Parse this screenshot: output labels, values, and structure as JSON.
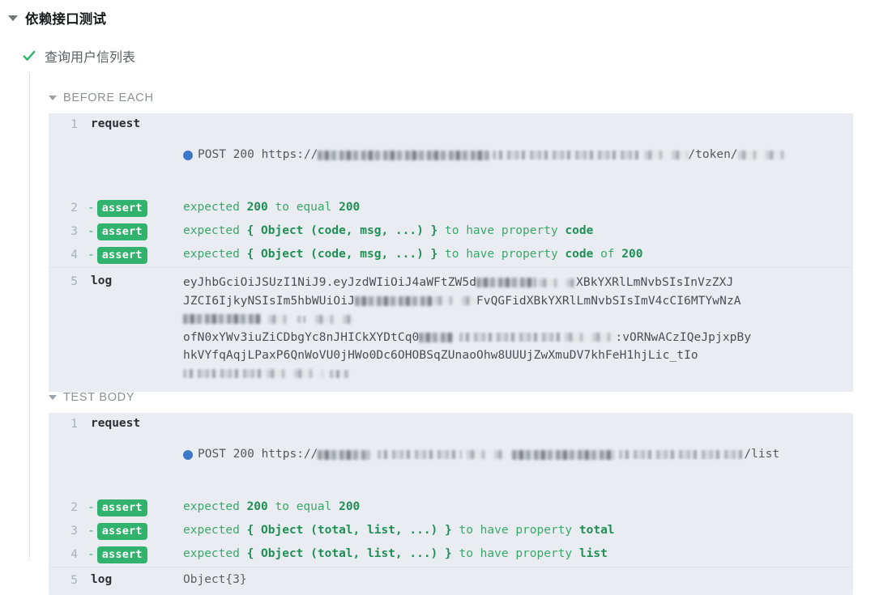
{
  "suite": {
    "title": "依赖接口测试",
    "caret_icon": "caret-down-icon"
  },
  "test": {
    "title": "查询用户信列表",
    "status_icon": "check-mark-icon",
    "status": "passed"
  },
  "colors": {
    "panel_bg": "#e9edf2",
    "assert_badge": "#31b36d",
    "assert_text": "#3aa86a",
    "request_dot": "#3c79c9",
    "check_green": "#29b36a",
    "row_number": "#a9b0bb",
    "group_label": "#8b9096"
  },
  "sections": [
    {
      "name": "BEFORE EACH",
      "caret_icon": "caret-down-icon",
      "rows": [
        {
          "num": "1",
          "type": "request",
          "command": "request",
          "dot_icon": "status-dot-icon",
          "method": "POST",
          "status": "200",
          "url_prefix": "https://",
          "url_visible_tail": "/token/",
          "url_redacted": true
        },
        {
          "num": "2",
          "type": "assert",
          "dash": "-",
          "badge": "assert",
          "message": "expected 200 to equal 200",
          "message_parts": [
            "expected ",
            "200",
            " to equal ",
            "200"
          ]
        },
        {
          "num": "3",
          "type": "assert",
          "dash": "-",
          "badge": "assert",
          "message": "expected { Object (code, msg, ...) } to have property code",
          "message_parts": [
            "expected ",
            "{ Object (code, msg, ...) }",
            " to have property ",
            "code"
          ]
        },
        {
          "num": "4",
          "type": "assert",
          "dash": "-",
          "badge": "assert",
          "message": "expected { Object (code, msg, ...) } to have property code of 200",
          "message_parts": [
            "expected ",
            "{ Object (code, msg, ...) }",
            " to have property ",
            "code",
            " of ",
            "200"
          ]
        },
        {
          "num": "5",
          "type": "log",
          "command": "log",
          "separator": true,
          "log_lines": [
            "eyJhbGciOiJSUzI1NiJ9.eyJzdWIiOiJ4aWFtZW5d",
            "XBkYXRlLmNvbSIsInVzZXJ",
            "JZCI6IjkyNSIsIm5hbWUiOiJ",
            "FvQGFidXBkYXRlLmNvbSIsImV4cCI6MTYwNzA",
            "ofN0xYWv3iuZiCDbgYc8nJHICkXYDtCq0",
            ":vORNwACzIQeJpjxpBy",
            "hkVYfqAqjLPaxP6QnWoVU0jHWo0Dc6OHOBSqZUnaoOhw8UUUjZwXmuDV7khFeH1hjLic_tIo"
          ],
          "log_redacted": true
        }
      ]
    },
    {
      "name": "TEST BODY",
      "caret_icon": "caret-down-icon",
      "rows": [
        {
          "num": "1",
          "type": "request",
          "command": "request",
          "dot_icon": "status-dot-icon",
          "method": "POST",
          "status": "200",
          "url_prefix": "https://",
          "url_visible_tail": "/list",
          "url_redacted": true
        },
        {
          "num": "2",
          "type": "assert",
          "dash": "-",
          "badge": "assert",
          "message": "expected 200 to equal 200",
          "message_parts": [
            "expected ",
            "200",
            " to equal ",
            "200"
          ]
        },
        {
          "num": "3",
          "type": "assert",
          "dash": "-",
          "badge": "assert",
          "message": "expected { Object (total, list, ...) } to have property total",
          "message_parts": [
            "expected ",
            "{ Object (total, list, ...) }",
            " to have property ",
            "total"
          ]
        },
        {
          "num": "4",
          "type": "assert",
          "dash": "-",
          "badge": "assert",
          "message": "expected { Object (total, list, ...) } to have property list",
          "message_parts": [
            "expected ",
            "{ Object (total, list, ...) }",
            " to have property ",
            "list"
          ]
        },
        {
          "num": "5",
          "type": "log",
          "command": "log",
          "separator": true,
          "log_text": "Object{3}"
        }
      ]
    }
  ],
  "labels": {
    "request_method_status_before": "POST 200 ",
    "request_method_status_body": "POST 200 "
  }
}
